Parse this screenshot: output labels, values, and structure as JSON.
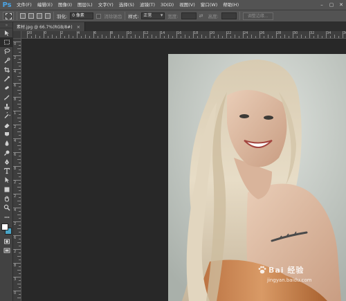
{
  "app": {
    "logo": "Ps"
  },
  "menu": {
    "items": [
      "文件(F)",
      "编辑(E)",
      "图像(I)",
      "图层(L)",
      "文字(Y)",
      "选择(S)",
      "滤镜(T)",
      "3D(D)",
      "视图(V)",
      "窗口(W)",
      "帮助(H)"
    ],
    "window_controls": [
      "–",
      "▢",
      "✕"
    ]
  },
  "options": {
    "feather_label": "羽化:",
    "feather_value": "0 像素",
    "antialias_label": "消除锯齿",
    "style_label": "样式:",
    "style_value": "正常",
    "width_label": "宽度:",
    "height_label": "高度:",
    "refine_edge_button": "调整边缘..."
  },
  "document": {
    "tab_title": "素材.jpg @ 66.7%(RGB/8#)",
    "tab_close": "×"
  },
  "rulers": {
    "top": [
      "20",
      "0",
      "2",
      "4",
      "6",
      "8",
      "10",
      "12",
      "14",
      "16",
      "18",
      "20",
      "22",
      "24",
      "26",
      "28",
      "30",
      "32",
      "34",
      "36"
    ],
    "left": [
      "0",
      "2",
      "4",
      "6",
      "8",
      "1",
      "2",
      "4",
      "6",
      "8",
      "2",
      "2",
      "4",
      "2",
      "6",
      "2",
      "8",
      "3",
      "0"
    ]
  },
  "tools": [
    "move-tool",
    "marquee-tool",
    "lasso-tool",
    "quick-select-tool",
    "crop-tool",
    "eyedropper-tool",
    "healing-brush-tool",
    "brush-tool",
    "clone-stamp-tool",
    "history-brush-tool",
    "eraser-tool",
    "gradient-tool",
    "blur-tool",
    "dodge-tool",
    "pen-tool",
    "type-tool",
    "path-select-tool",
    "shape-tool",
    "hand-tool",
    "zoom-tool"
  ],
  "colors": {
    "foreground": "#ffffff",
    "background": "#4aa6c8"
  },
  "watermark": {
    "text": "Bai 经验",
    "sub": "jingyan.baidu.com"
  }
}
